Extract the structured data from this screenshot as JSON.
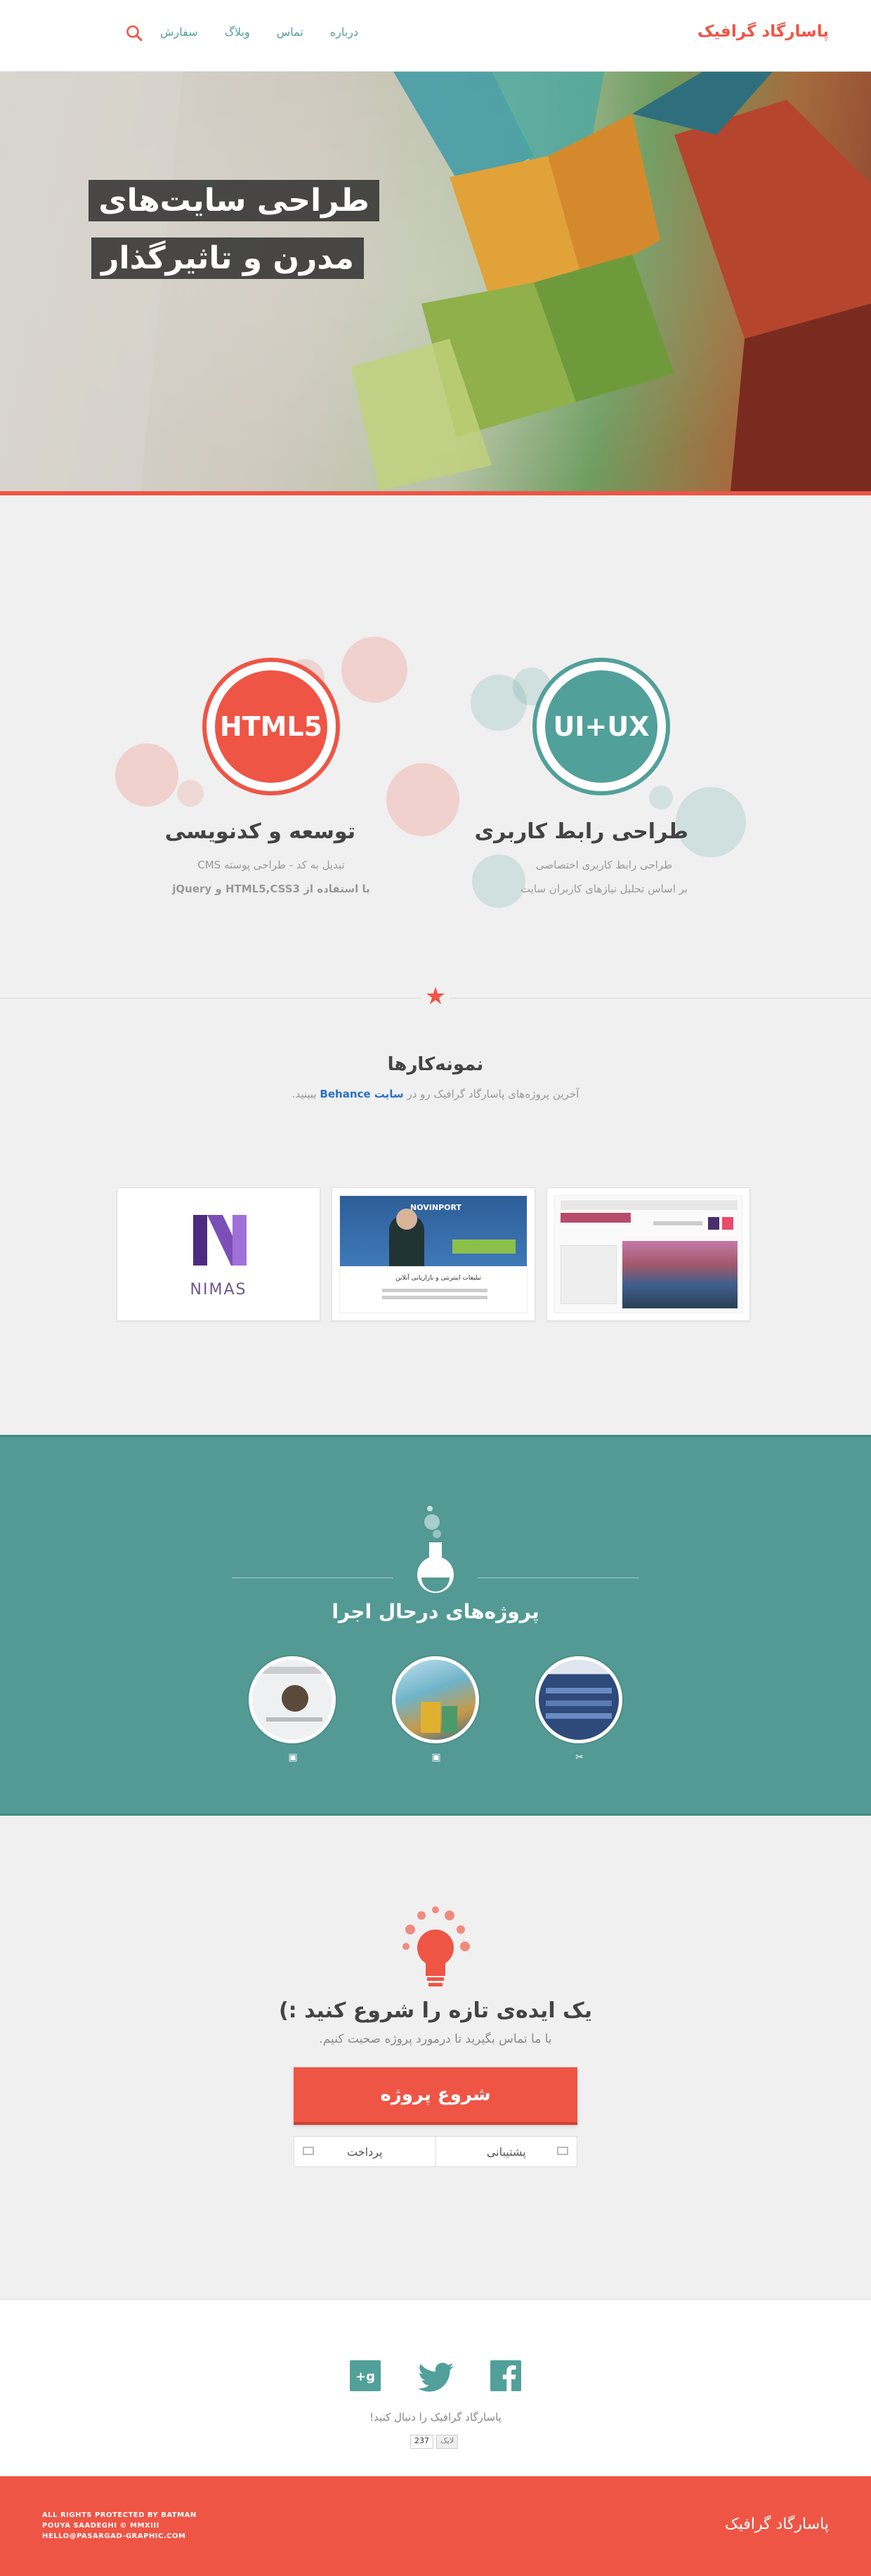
{
  "header": {
    "logo": "پاسارگاد گرافیک",
    "nav": [
      "سفارش",
      "وبلاگ",
      "تماس",
      "درباره"
    ],
    "search_icon": "search-icon"
  },
  "hero": {
    "line1": "طراحی سایت‌های",
    "line2": "مدرن و تاثیرگذار"
  },
  "services": [
    {
      "badge": "UI+UX",
      "title": "طراحی رابط کاربری",
      "desc1": "طراحی رابط کاربری اختصاصی",
      "desc2": "بر اساس تحلیل نیازهای کاربران سایت",
      "color": "#52a09a"
    },
    {
      "badge": "HTML5",
      "title": "توسعه و کدنویسی",
      "desc1": "تبدیل به کد - طراحی پوسته CMS",
      "desc2": "با استفاده از HTML5,CSS3 و jQuery",
      "color": "#ee5545"
    }
  ],
  "portfolio": {
    "title": "نمونه‌کارها",
    "desc_pre": "آخرین پروژه‌های پاسارگاد گرافیک رو در",
    "desc_link": "سایت Behance",
    "desc_post": "ببینید.",
    "items": [
      {
        "name": "site-screenshot-1"
      },
      {
        "name": "novinport-site",
        "brand": "NOVINPORT",
        "caption": "تبلیغات اینترنتی و بازاریابی آنلاین"
      },
      {
        "name": "nimas-logo",
        "brand": "NIMAS"
      }
    ]
  },
  "projects": {
    "title": "پروژه‌های درحال اجرا"
  },
  "cta": {
    "title": "یک ایده‌ی تازه را شروع کنید :)",
    "subtitle": "با ما تماس بگیرید تا درمورد پروژه صحبت کنیم.",
    "start_button": "شروع پروژه",
    "support_button": "پشتیبانی",
    "payment_button": "پرداخت"
  },
  "social": {
    "follow_text": "پاسارگاد گرافیک را دنبال کنید!",
    "like_label": "لایک",
    "like_count": "237"
  },
  "footer": {
    "logo": "پاسارگاد گرافیک",
    "line1": "ALL RIGHTS PROTECTED BY BATMAN",
    "line2": "POUYA SAADEGHI © MMXIII",
    "line3": "HELLO@PASARGAD-GRAPHIC.COM"
  },
  "colors": {
    "accent": "#ee5545",
    "teal": "#52a09a"
  }
}
